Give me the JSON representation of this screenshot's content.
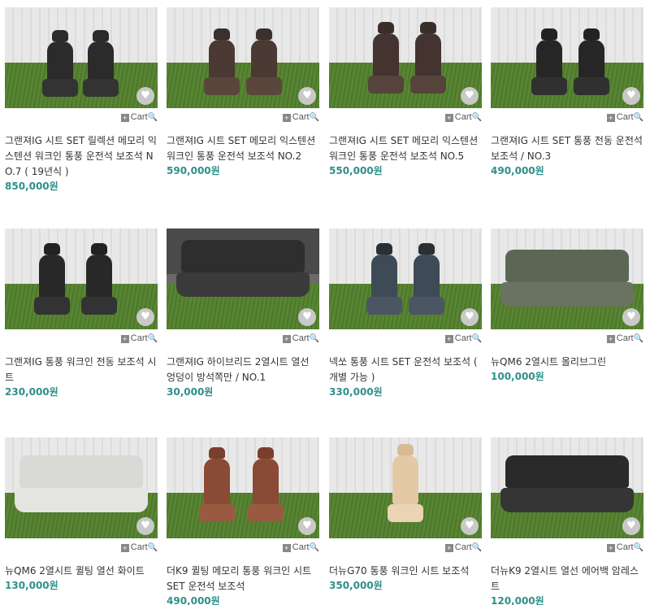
{
  "products": [
    {
      "title": "그랜져IG 시트 SET 릴렉션 메모리 익스텐션 워크인 통풍 운전석 보조석 NO.7 ( 19년식 )",
      "price": "850,000원",
      "cart": "Cart",
      "image": "black-leather-front-seats",
      "seat_color": "#2b2b2b"
    },
    {
      "title": "그랜져IG 시트 SET 메모리 익스텐션 워크인 통풍 운전석 보조석 NO.2",
      "price": "590,000원",
      "cart": "Cart",
      "image": "brown-leather-front-seats",
      "seat_color": "#4a3a33"
    },
    {
      "title": "그랜져IG 시트 SET 메모리 익스텐션 워크인 통풍 운전석 보조석 NO.5",
      "price": "550,000원",
      "cart": "Cart",
      "image": "brown-leather-front-seats",
      "seat_color": "#433430"
    },
    {
      "title": "그랜져IG 시트 SET 통풍 전동 운전석 보조석 / NO.3",
      "price": "490,000원",
      "cart": "Cart",
      "image": "black-leather-front-seats",
      "seat_color": "#262626"
    },
    {
      "title": "그랜져IG 통풍 워크인 전동 보조석 시트",
      "price": "230,000원",
      "cart": "Cart",
      "image": "black-leather-front-seats",
      "seat_color": "#282828"
    },
    {
      "title": "그랜져IG 하이브리드 2열시트 열선 엉덩이 방석쪽만 / NO.1",
      "price": "30,000원",
      "cart": "Cart",
      "image": "black-rear-bench",
      "seat_color": "#2e2e2e"
    },
    {
      "title": "넥쏘 통풍 시트 SET 운전석 보조석 ( 개별 가능 )",
      "price": "330,000원",
      "cart": "Cart",
      "image": "grey-blue-front-seats",
      "seat_color": "#3e4a56"
    },
    {
      "title": "뉴QM6 2열시트 올리브그린",
      "price": "100,000원",
      "cart": "Cart",
      "image": "olive-rear-bench",
      "seat_color": "#5d6655"
    },
    {
      "title": "뉴QM6 2열시트 퀼팅 열선 화이트",
      "price": "130,000원",
      "cart": "Cart",
      "image": "white-rear-bench",
      "seat_color": "#d9d9d6"
    },
    {
      "title": "더K9 퀼팅 메모리 통풍 워크인 시트 SET 운전석 보조석",
      "price": "490,000원",
      "cart": "Cart",
      "image": "tan-brown-front-seats",
      "seat_color": "#8a4a35"
    },
    {
      "title": "더뉴G70 통풍 워크인 시트 보조석",
      "price": "350,000원",
      "cart": "Cart",
      "image": "beige-single-seat",
      "seat_color": "#e3c9a6"
    },
    {
      "title": "더뉴K9 2열시트 열선 에어백 암레스트",
      "price": "120,000원",
      "cart": "Cart",
      "image": "black-rear-bench",
      "seat_color": "#2a2a2a"
    }
  ]
}
